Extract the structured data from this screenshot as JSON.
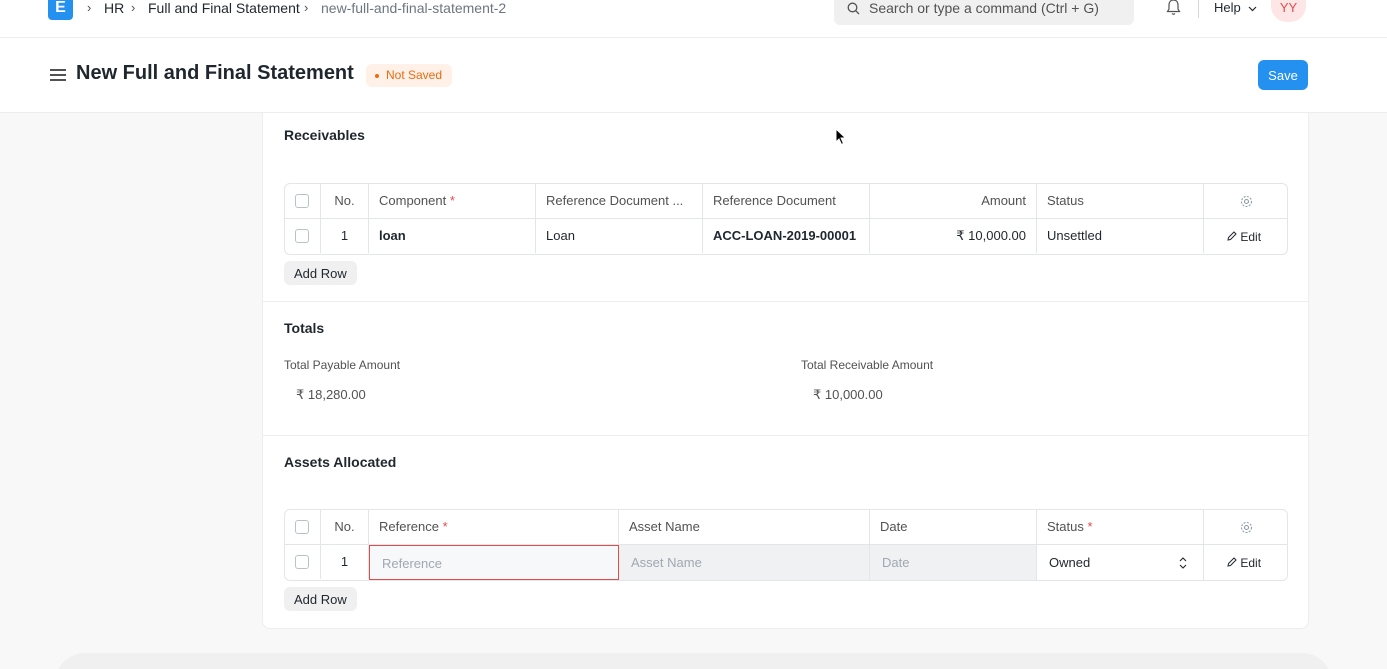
{
  "navbar": {
    "logo_letter": "E",
    "breadcrumbs": [
      "HR",
      "Full and Final Statement",
      "new-full-and-final-statement-2"
    ],
    "search_placeholder": "Search or type a command (Ctrl + G)",
    "help_label": "Help",
    "avatar_initials": "YY"
  },
  "page": {
    "title": "New Full and Final Statement",
    "status_indicator": "Not Saved",
    "save_label": "Save"
  },
  "receivables": {
    "section_title": "Receivables",
    "columns": [
      "No.",
      "Component",
      "Reference Document ...",
      "Reference Document",
      "Amount",
      "Status"
    ],
    "rows": [
      {
        "no": "1",
        "component": "loan",
        "reference_document_type": "Loan",
        "reference_document": "ACC-LOAN-2019-00001",
        "amount": "₹ 10,000.00",
        "status": "Unsettled",
        "edit_label": "Edit"
      }
    ],
    "add_row_label": "Add Row"
  },
  "totals": {
    "section_title": "Totals",
    "total_payable_label": "Total Payable Amount",
    "total_payable_value": "₹ 18,280.00",
    "total_receivable_label": "Total Receivable Amount",
    "total_receivable_value": "₹ 10,000.00"
  },
  "assets": {
    "section_title": "Assets Allocated",
    "columns": [
      "No.",
      "Reference",
      "Asset Name",
      "Date",
      "Status"
    ],
    "rows": [
      {
        "no": "1",
        "reference_placeholder": "Reference",
        "asset_name_placeholder": "Asset Name",
        "date_placeholder": "Date",
        "status": "Owned",
        "edit_label": "Edit"
      }
    ],
    "add_row_label": "Add Row"
  },
  "required_marker": "*",
  "colors": {
    "primary": "#2490ef",
    "not_saved": "#e86c13",
    "required": "#e24c4c",
    "error_border": "#e24c4c"
  }
}
